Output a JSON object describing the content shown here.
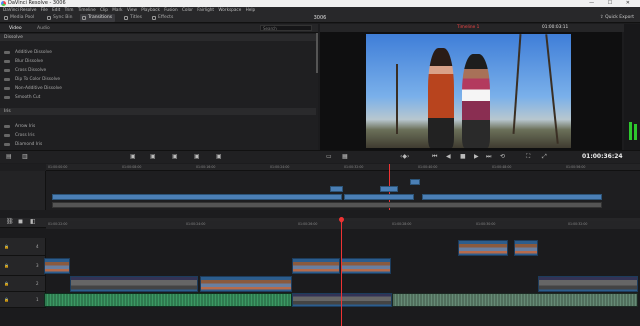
{
  "titlebar": {
    "title": "DaVinci Resolve - 3006",
    "controls": "— ☐ ✕"
  },
  "menu": [
    "DaVinci Resolve",
    "File",
    "Edit",
    "Trim",
    "Timeline",
    "Clip",
    "Mark",
    "View",
    "Playback",
    "Fusion",
    "Color",
    "Fairlight",
    "Workspace",
    "Help"
  ],
  "toolbar": {
    "media_pool": "Media Pool",
    "sync_bin": "Sync Bin",
    "transitions": "Transitions",
    "titles": "Titles",
    "effects": "Effects",
    "project_title": "3006",
    "quick_export": "Quick Export"
  },
  "effects_panel": {
    "tabs": [
      "Video",
      "Audio"
    ],
    "search_placeholder": "Search",
    "dissolve_header": "Dissolve",
    "dissolve_items": [
      "Additive Dissolve",
      "Blur Dissolve",
      "Cross Dissolve",
      "Dip To Color Dissolve",
      "Non-Additive Dissolve",
      "Smooth Cut"
    ],
    "iris_header": "Iris",
    "iris_items": [
      "Arrow Iris",
      "Cross Iris",
      "Diamond Iris"
    ]
  },
  "viewer": {
    "timeline_name": "Timeline 1",
    "source_timecode": "01:00:03:11",
    "record_timecode": "01:00:36:24"
  },
  "timeline": {
    "upper_ruler": [
      "01:00:00:00",
      "01:00:08:00",
      "01:00:16:00",
      "01:00:24:00",
      "01:00:32:00",
      "01:00:40:00",
      "01:00:48:00",
      "01:00:56:00"
    ],
    "lower_ruler": [
      "01:00:22:00",
      "01:00:24:00",
      "01:00:26:00",
      "01:00:28:00",
      "01:00:30:00",
      "01:00:32:00",
      "01:00:34:00"
    ],
    "tracks": [
      {
        "id": "V4",
        "label": "4"
      },
      {
        "id": "V3",
        "label": "3"
      },
      {
        "id": "V2",
        "label": "2"
      },
      {
        "id": "A1",
        "label": "1"
      }
    ]
  },
  "colors": {
    "accent": "#e33333",
    "video_clip": "#4b7fb5",
    "audio_clip": "#3b9863"
  }
}
